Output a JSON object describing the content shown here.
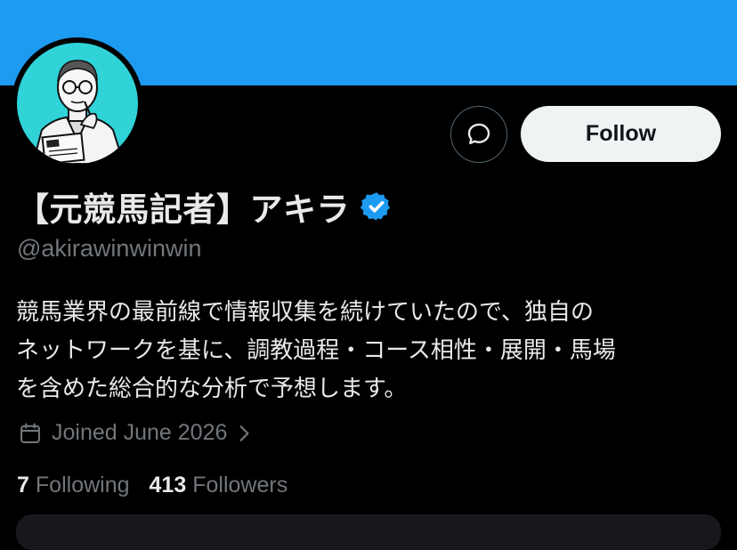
{
  "profile": {
    "display_name": "【元競馬記者】アキラ",
    "handle": "@akirawinwinwin",
    "verified": true,
    "bio_lines": [
      "競馬業界の最前線で情報収集を続けていたので、独自の",
      "ネットワークを基に、調教過程・コース相性・展開・馬場",
      "を含めた総合的な分析で予想します。"
    ],
    "joined": "Joined June 2026",
    "following_count": "7",
    "following_label": "Following",
    "followers_count": "413",
    "followers_label": "Followers"
  },
  "actions": {
    "follow_label": "Follow",
    "message_icon": "message-bubble-icon"
  },
  "colors": {
    "banner": "#1d9bf0",
    "background": "#000000",
    "verified": "#1d9bf0",
    "avatar_bg": "#2fd3d8",
    "secondary_text": "#71767b"
  }
}
